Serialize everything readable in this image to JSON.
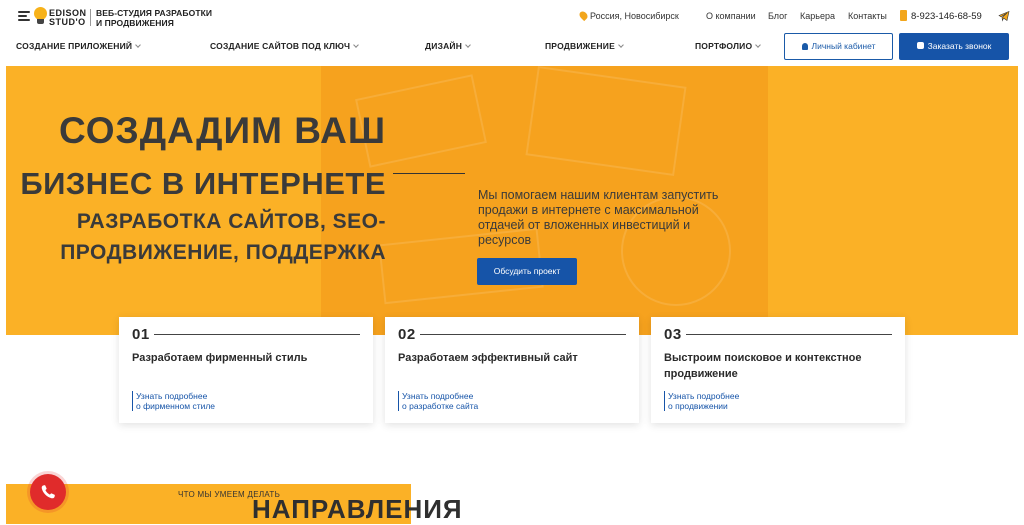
{
  "header": {
    "logo_line1": "EDISON",
    "logo_line2": "STUD'O",
    "tagline_line1": "ВЕБ-СТУДИЯ РАЗРАБОТКИ",
    "tagline_line2": "И ПРОДВИЖЕНИЯ",
    "location": "Россия, Новосибирск",
    "links": [
      "О компании",
      "Блог",
      "Карьера",
      "Контакты"
    ],
    "phone": "8-923-146-68-59"
  },
  "nav": {
    "items": [
      {
        "label": "СОЗДАНИЕ ПРИЛОЖЕНИЙ"
      },
      {
        "label": "СОЗДАНИЕ САЙТОВ ПОД КЛЮЧ"
      },
      {
        "label": "ДИЗАЙН"
      },
      {
        "label": "ПРОДВИЖЕНИЕ"
      },
      {
        "label": "ПОРТФОЛИО"
      }
    ],
    "cabinet_label": "Личный кабинет",
    "call_label": "Заказать звонок"
  },
  "hero": {
    "title_line1": "СОЗДАДИМ ВАШ",
    "title_line2": "БИЗНЕС В ИНТЕРНЕТЕ",
    "subtitle_line1": "РАЗРАБОТКА САЙТОВ, SEO-",
    "subtitle_line2": "ПРОДВИЖЕНИЕ, ПОДДЕРЖКА",
    "description": "Мы помогаем нашим клиентам запустить продажи в интернете с максимальной отдачей от вложенных инвестиций и ресурсов",
    "cta_label": "Обсудить проект"
  },
  "cards": [
    {
      "number": "01",
      "title": "Разработаем фирменный стиль",
      "link_line1": "Узнать подробнее",
      "link_line2": "о фирменном стиле"
    },
    {
      "number": "02",
      "title": "Разработаем эффективный сайт",
      "link_line1": "Узнать подробнее",
      "link_line2": "о разработке сайта"
    },
    {
      "number": "03",
      "title": "Выстроим поисковое и контекстное продвижение",
      "link_line1": "Узнать подробнее",
      "link_line2": "о продвижении"
    }
  ],
  "section": {
    "eyebrow": "ЧТО МЫ УМЕЕМ ДЕЛАТЬ",
    "heading": "НАПРАВЛЕНИЯ"
  },
  "colors": {
    "accent_yellow": "#fbb126",
    "accent_orange": "#f6a21e",
    "primary_blue": "#1654a8",
    "call_red": "#e02b2b"
  }
}
